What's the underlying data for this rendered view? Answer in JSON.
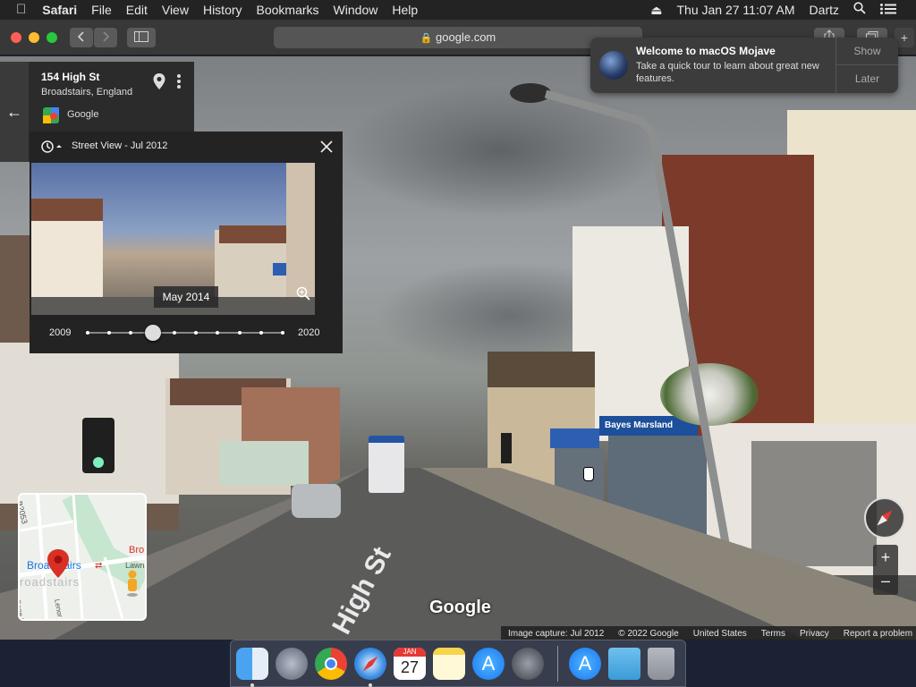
{
  "menubar": {
    "app_name": "Safari",
    "items": [
      "File",
      "Edit",
      "View",
      "History",
      "Bookmarks",
      "Window",
      "Help"
    ],
    "datetime": "Thu Jan 27  11:07 AM",
    "user": "Dartz"
  },
  "toolbar": {
    "url": "google.com"
  },
  "place": {
    "title": "154 High St",
    "subtitle": "Broadstairs, England",
    "provider": "Google"
  },
  "street_view": {
    "header": "Street View - Jul 2012",
    "preview_date": "May 2014",
    "timeline_start": "2009",
    "timeline_end": "2020",
    "timeline_stops": 10,
    "selected_index": 3
  },
  "notification": {
    "title": "Welcome to macOS Mojave",
    "body": "Take a quick tour to learn about great new features.",
    "show_label": "Show",
    "later_label": "Later"
  },
  "minimap": {
    "place_label": "Broadstairs",
    "town_label": "roadstairs",
    "road_label": "B2053",
    "corner_label": "Bro",
    "lane_label": "Lawn",
    "street_a": "Gone Rd",
    "street_b": "Lenor Rd"
  },
  "street_overlays": {
    "brand": "Google",
    "road_marking": "High St",
    "shop_sign": "Bayes Marsland"
  },
  "footer": {
    "capture": "Image capture: Jul 2012",
    "copyright": "© 2022 Google",
    "region": "United States",
    "terms": "Terms",
    "privacy": "Privacy",
    "report": "Report a problem"
  },
  "dock": {
    "calendar_month": "JAN",
    "calendar_day": "27",
    "apps": [
      "finder",
      "launchpad",
      "chrome",
      "safari",
      "calendar",
      "notes",
      "app-store",
      "system-preferences",
      "app-store-download",
      "downloads-folder",
      "trash"
    ]
  },
  "colors": {
    "accent_blue": "#1a73e8",
    "pin_red": "#d93025",
    "pegman": "#f5a623"
  }
}
